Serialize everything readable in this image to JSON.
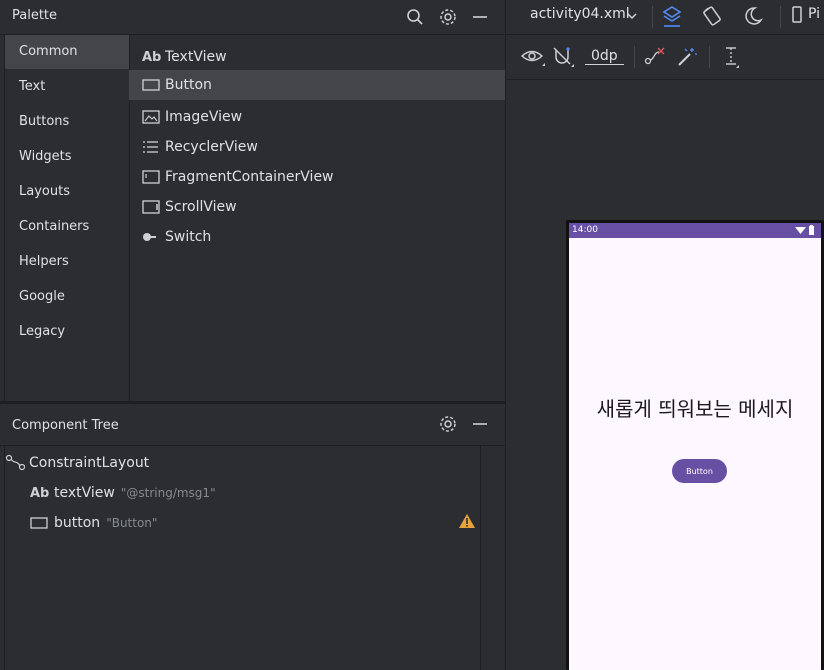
{
  "palette": {
    "title": "Palette",
    "categories": [
      {
        "label": "Common"
      },
      {
        "label": "Text"
      },
      {
        "label": "Buttons"
      },
      {
        "label": "Widgets"
      },
      {
        "label": "Layouts"
      },
      {
        "label": "Containers"
      },
      {
        "label": "Helpers"
      },
      {
        "label": "Google"
      },
      {
        "label": "Legacy"
      }
    ],
    "selected_category": "Common",
    "widgets": [
      {
        "label": "TextView",
        "icon": "ab-text-icon",
        "glyph": "Ab"
      },
      {
        "label": "Button",
        "icon": "button-icon"
      },
      {
        "label": "ImageView",
        "icon": "image-icon"
      },
      {
        "label": "RecyclerView",
        "icon": "list-icon"
      },
      {
        "label": "FragmentContainerView",
        "icon": "fragment-icon"
      },
      {
        "label": "ScrollView",
        "icon": "scrollview-icon"
      },
      {
        "label": "Switch",
        "icon": "switch-icon"
      }
    ],
    "selected_widget": "Button"
  },
  "component_tree": {
    "title": "Component Tree",
    "root": {
      "label": "ConstraintLayout"
    },
    "children": [
      {
        "label": "textView",
        "hint": "\"@string/msg1\"",
        "glyph": "Ab"
      },
      {
        "label": "button",
        "hint": "\"Button\"",
        "warning": true
      }
    ]
  },
  "editor": {
    "file_name": "activity04.xml",
    "margin_value": "0dp",
    "tab_cut": "Pi"
  },
  "phone": {
    "time": "14:00",
    "message": "새롭게 띄워보는 메세지",
    "button_label": "Button"
  },
  "colors": {
    "accent": "#6750a4",
    "selection": "#43454a",
    "warning": "#e8a33d",
    "blue_icon": "#548af7"
  }
}
